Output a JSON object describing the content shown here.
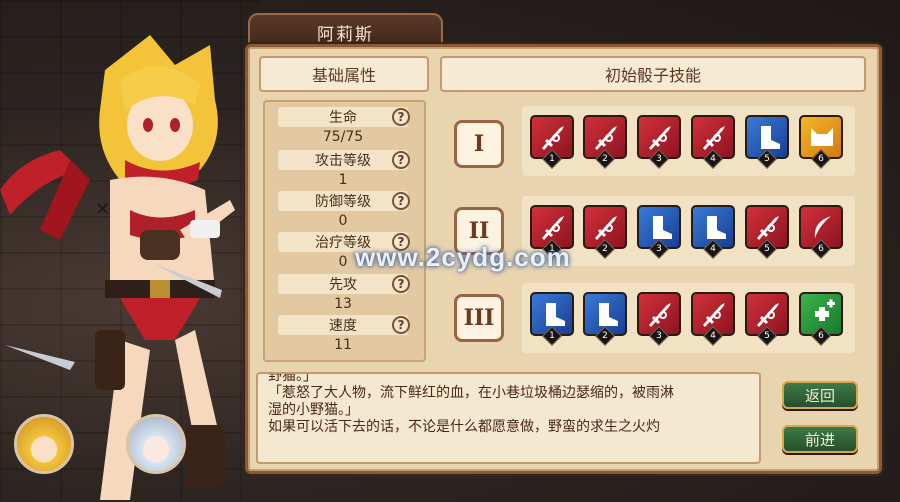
{
  "character_name": "阿莉斯",
  "headers": {
    "attributes": "基础属性",
    "dice_skills": "初始骰子技能"
  },
  "stats": [
    {
      "label": "生命",
      "value": "75/75"
    },
    {
      "label": "攻击等级",
      "value": "1"
    },
    {
      "label": "防御等级",
      "value": "0"
    },
    {
      "label": "治疗等级",
      "value": "0"
    },
    {
      "label": "先攻",
      "value": "13"
    },
    {
      "label": "速度",
      "value": "11"
    }
  ],
  "help_glyph": "?",
  "dice_sets": [
    {
      "numeral": "I",
      "dice": [
        {
          "num": "1",
          "color": "red",
          "icon": "dagger-icon"
        },
        {
          "num": "2",
          "color": "red",
          "icon": "dagger-icon"
        },
        {
          "num": "3",
          "color": "red",
          "icon": "dagger-icon"
        },
        {
          "num": "4",
          "color": "red",
          "icon": "dagger-icon"
        },
        {
          "num": "5",
          "color": "blue",
          "icon": "boot-icon"
        },
        {
          "num": "6",
          "color": "yellow",
          "icon": "cat-icon"
        }
      ]
    },
    {
      "numeral": "II",
      "dice": [
        {
          "num": "1",
          "color": "red",
          "icon": "dagger-icon"
        },
        {
          "num": "2",
          "color": "red",
          "icon": "dagger-icon"
        },
        {
          "num": "3",
          "color": "blue",
          "icon": "boot-icon"
        },
        {
          "num": "4",
          "color": "blue",
          "icon": "boot-icon"
        },
        {
          "num": "5",
          "color": "red",
          "icon": "dagger-icon"
        },
        {
          "num": "6",
          "color": "red",
          "icon": "slash-icon"
        }
      ]
    },
    {
      "numeral": "III",
      "dice": [
        {
          "num": "1",
          "color": "blue",
          "icon": "boot-icon"
        },
        {
          "num": "2",
          "color": "blue",
          "icon": "boot-icon"
        },
        {
          "num": "3",
          "color": "red",
          "icon": "dagger-icon"
        },
        {
          "num": "4",
          "color": "red",
          "icon": "dagger-icon"
        },
        {
          "num": "5",
          "color": "red",
          "icon": "dagger-icon"
        },
        {
          "num": "6",
          "color": "green",
          "icon": "heal-plus-icon"
        }
      ]
    }
  ],
  "description": {
    "partial_line": "野猫。」",
    "line1": "「惹怒了大人物，流下鲜红的血，在小巷垃圾桶边瑟缩的，被雨淋",
    "line2": "湿的小野猫。」",
    "line3": "如果可以活下去的话，不论是什么都愿意做，野蛮的求生之火灼"
  },
  "buttons": {
    "back": "返回",
    "next": "前进"
  },
  "watermark": "www.2cydg.com",
  "colors": {
    "red_die": "#c42a34",
    "blue_die": "#2f68c8",
    "yellow_die": "#f0aa28",
    "green_die": "#34a848",
    "panel": "#e9d4b0",
    "button": "#2f6a3a"
  }
}
